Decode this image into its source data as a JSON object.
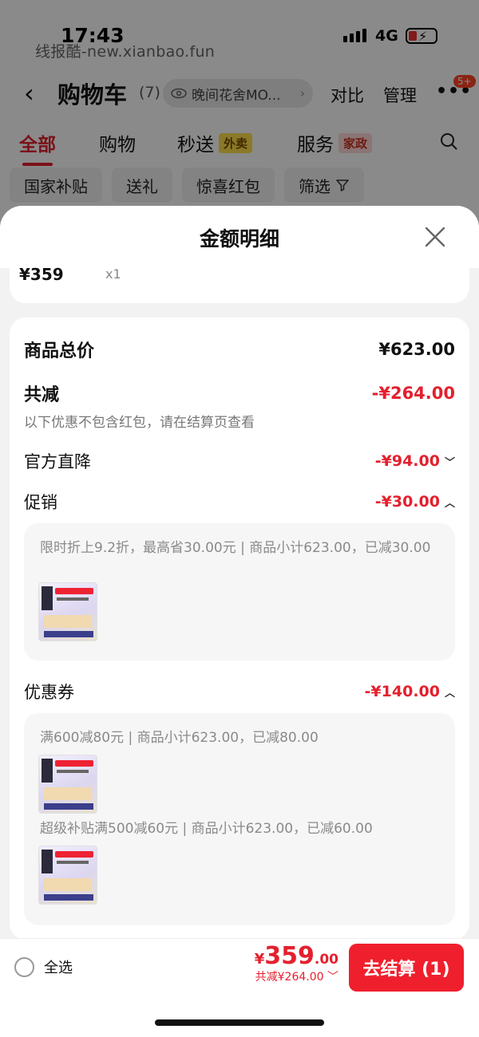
{
  "status_bar": {
    "time": "17:43",
    "network": "4G"
  },
  "watermark": "线报酷-new.xianbao.fun",
  "nav": {
    "title": "购物车",
    "count": "(7)",
    "shop_pill": "晚间花舍MO...",
    "compare": "对比",
    "manage": "管理",
    "more_badge": "5+"
  },
  "tabs": [
    {
      "label": "全部"
    },
    {
      "label": "购物"
    },
    {
      "label": "秒送",
      "tag": "外卖"
    },
    {
      "label": "服务",
      "tag": "家政"
    }
  ],
  "chips": [
    "国家补贴",
    "送礼",
    "惊喜红包",
    "筛选"
  ],
  "sheet": {
    "title": "金额明细",
    "item": {
      "price": "¥359",
      "qty": "x1"
    },
    "goods_total": {
      "label": "商品总价",
      "value": "¥623.00"
    },
    "total_reduction": {
      "label": "共减",
      "value": "-¥264.00"
    },
    "note": "以下优惠不包含红包，请在结算页查看",
    "official_drop": {
      "label": "官方直降",
      "value": "-¥94.00"
    },
    "promotion": {
      "label": "促销",
      "value": "-¥30.00",
      "detail": "限时折上9.2折，最高省30.00元 | 商品小计623.00，已减30.00"
    },
    "coupon": {
      "label": "优惠券",
      "value": "-¥140.00",
      "detail_1": "满600减80元 | 商品小计623.00，已减80.00",
      "detail_2": "超级补贴满500减60元 | 商品小计623.00，已减60.00"
    }
  },
  "bottom_bar": {
    "select_all": "全选",
    "currency": "¥",
    "price_int": "359",
    "price_dec": ".00",
    "saved": "共减¥264.00",
    "checkout": "去结算 (1)"
  },
  "colors": {
    "accent": "#e4202e",
    "checkout_bg": "#f01f2d"
  }
}
